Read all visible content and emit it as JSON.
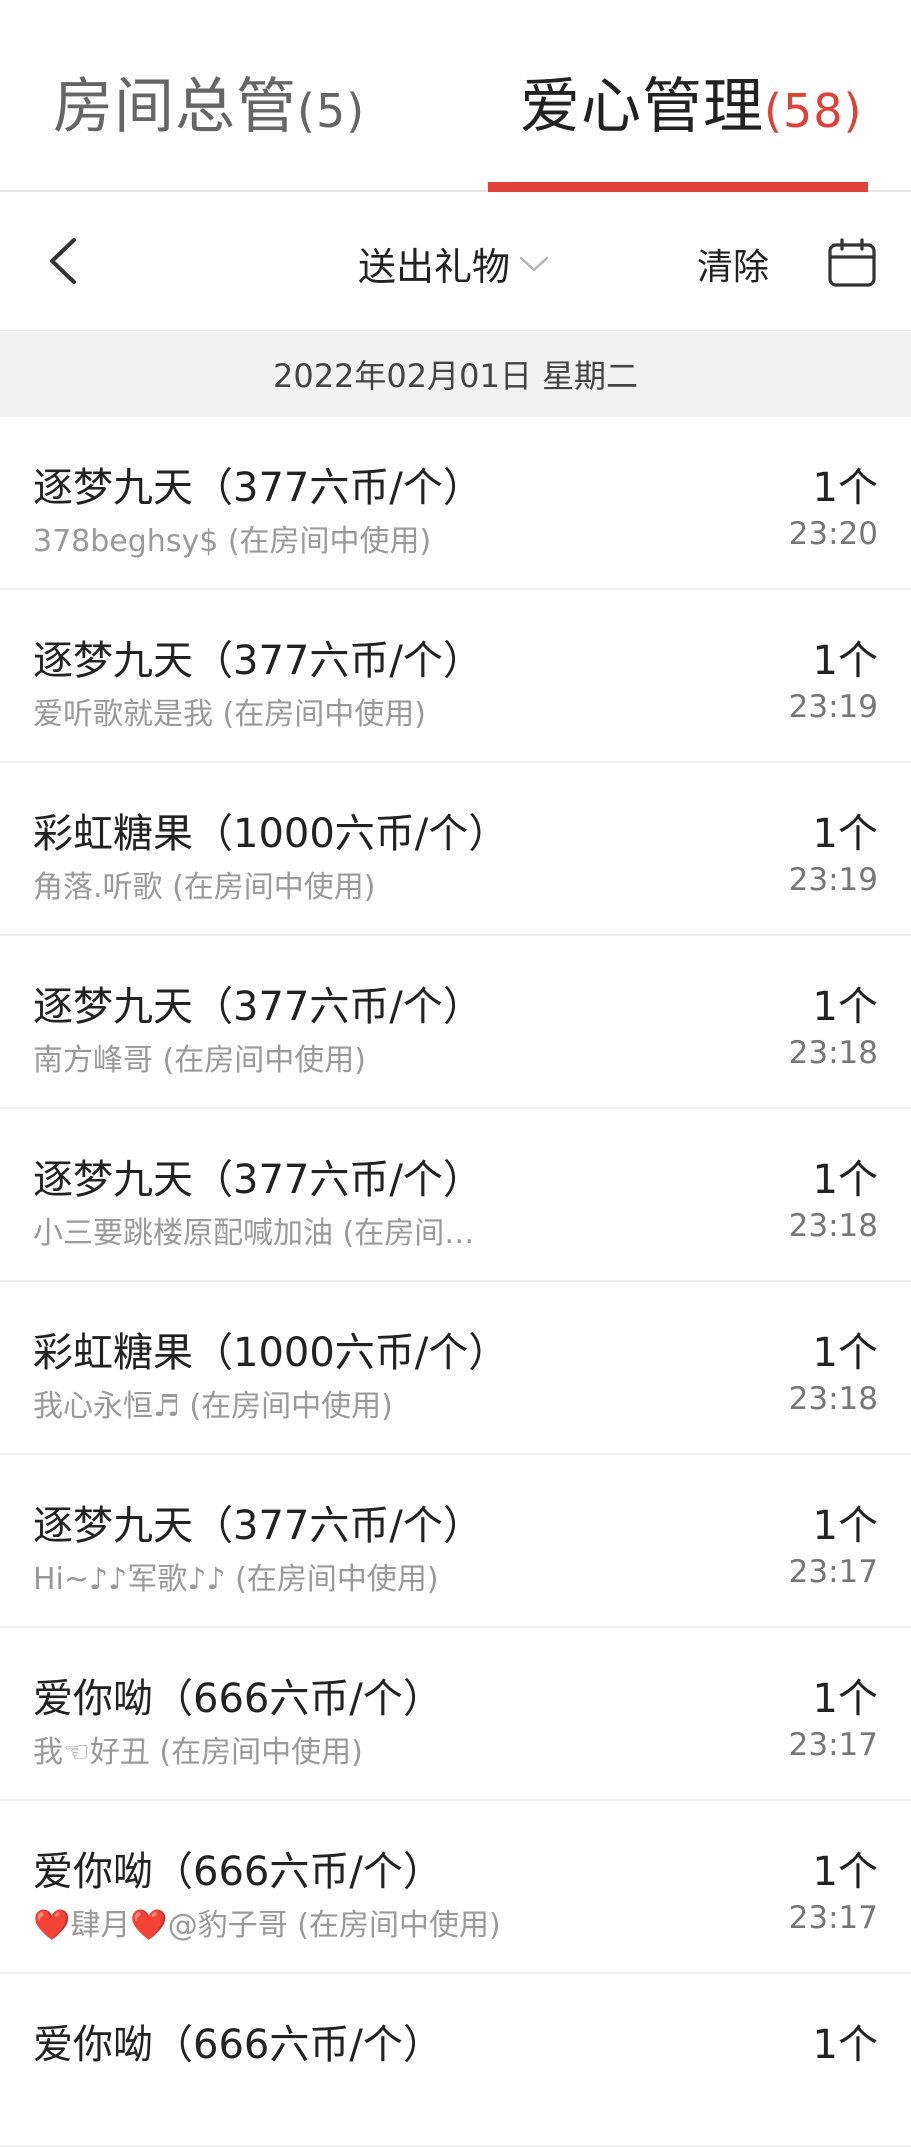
{
  "tabs": [
    {
      "label": "房间总管",
      "count": "(5)"
    },
    {
      "label": "爱心管理",
      "count": "(58)"
    }
  ],
  "toolbar": {
    "filter_label": "送出礼物",
    "clear_label": "清除"
  },
  "date_header": "2022年02月01日 星期二",
  "records": [
    {
      "title": "逐梦九天（377六币/个）",
      "sub": "378beghsy$ (在房间中使用)",
      "qty": "1个",
      "time": "23:20"
    },
    {
      "title": "逐梦九天（377六币/个）",
      "sub": "爱听歌就是我 (在房间中使用)",
      "qty": "1个",
      "time": "23:19"
    },
    {
      "title": "彩虹糖果（1000六币/个）",
      "sub": "角落.听歌 (在房间中使用)",
      "qty": "1个",
      "time": "23:19"
    },
    {
      "title": "逐梦九天（377六币/个）",
      "sub": "南方峰哥 (在房间中使用)",
      "qty": "1个",
      "time": "23:18"
    },
    {
      "title": "逐梦九天（377六币/个）",
      "sub": "小三要跳楼原配喊加油 (在房间…",
      "qty": "1个",
      "time": "23:18"
    },
    {
      "title": "彩虹糖果（1000六币/个）",
      "sub": "我心永恒♬ (在房间中使用)",
      "qty": "1个",
      "time": "23:18"
    },
    {
      "title": "逐梦九天（377六币/个）",
      "sub": "Hi~♪♪军歌♪♪ (在房间中使用)",
      "qty": "1个",
      "time": "23:17"
    },
    {
      "title": "爱你呦（666六币/个）",
      "sub": "我☜好丑 (在房间中使用)",
      "qty": "1个",
      "time": "23:17"
    },
    {
      "title": "爱你呦（666六币/个）",
      "sub": "❤️肆月❤️@豹子哥 (在房间中使用)",
      "qty": "1个",
      "time": "23:17"
    },
    {
      "title": "爱你呦（666六币/个）",
      "sub": "",
      "qty": "1个",
      "time": ""
    }
  ],
  "colors": {
    "accent": "#e0423a",
    "date_bar_bg": "#f2f2f2",
    "muted_text": "#9a9a9a"
  },
  "icons": [
    "back-arrow-icon",
    "chevron-down-icon",
    "calendar-icon"
  ]
}
